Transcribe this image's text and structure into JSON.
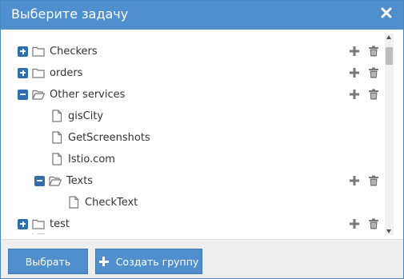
{
  "dialog": {
    "title": "Выберите задачу",
    "close_icon": "close-icon"
  },
  "tree": [
    {
      "label": "Checkers",
      "type": "folder",
      "state": "collapsed",
      "actions": true
    },
    {
      "label": "orders",
      "type": "folder",
      "state": "collapsed",
      "actions": true
    },
    {
      "label": "Other services",
      "type": "folder",
      "state": "expanded",
      "actions": true
    },
    {
      "label": "gisCity",
      "type": "file",
      "actions": false
    },
    {
      "label": "GetScreenshots",
      "type": "file",
      "actions": false
    },
    {
      "label": "Istio.com",
      "type": "file",
      "actions": false
    },
    {
      "label": "Texts",
      "type": "folder",
      "state": "expanded",
      "actions": true
    },
    {
      "label": "CheckText",
      "type": "file",
      "actions": false
    },
    {
      "label": "test",
      "type": "folder",
      "state": "collapsed",
      "actions": true
    }
  ],
  "footer": {
    "select_label": "Выбрать",
    "create_group_label": "Создать группу"
  },
  "colors": {
    "accent": "#4f8fce",
    "toggle": "#2f6fae",
    "icon_gray": "#777777"
  }
}
